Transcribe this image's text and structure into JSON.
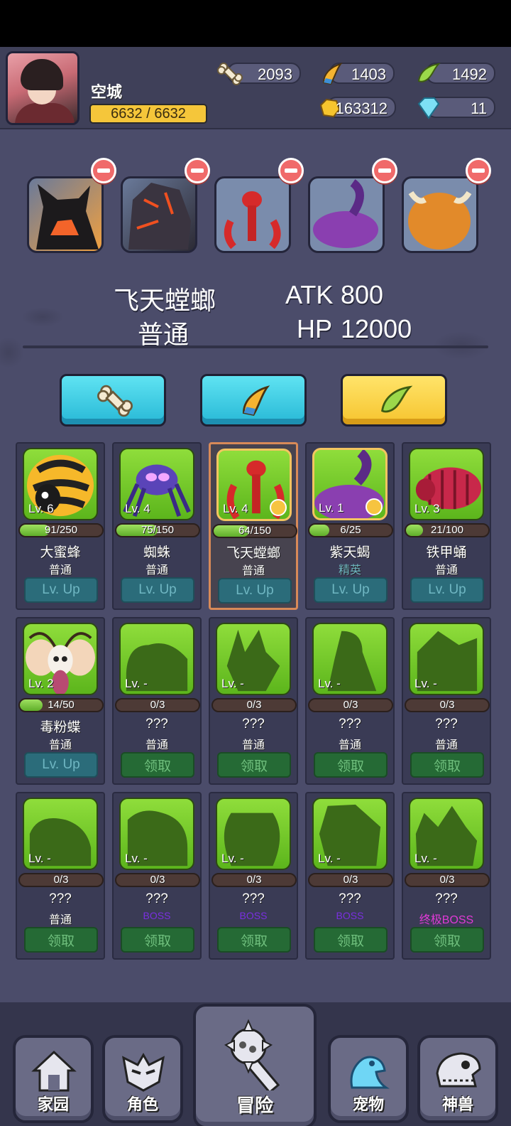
{
  "player": {
    "name": "空城",
    "hp_text": "6632 / 6632"
  },
  "resources": {
    "bone": "2093",
    "horn": "1403",
    "leaf": "1492",
    "gold": "163312",
    "diamond": "11"
  },
  "colors": {
    "bg": "#4b4c6a",
    "cell_green": "#8fdd3b",
    "btn_blue": "#27b8d6",
    "btn_yellow": "#f6c42e",
    "rank_elite": "#6fb6c2",
    "rank_boss": "#7a2fe0",
    "rank_ultimate_boss": "#e03ad6"
  },
  "team": [
    {
      "name": "fox-pet",
      "icon": "fox"
    },
    {
      "name": "rock-golem-pet",
      "icon": "rock"
    },
    {
      "name": "mantis-pet",
      "icon": "mantis"
    },
    {
      "name": "scorpion-pet",
      "icon": "scorpion"
    },
    {
      "name": "yak-pet",
      "icon": "yak"
    }
  ],
  "selected": {
    "name": "飞天螳螂",
    "rank": "普通",
    "atk_label": "ATK",
    "atk_value": "800",
    "hp_label": "HP",
    "hp_value": "12000"
  },
  "tabs": [
    {
      "icon": "bone-icon",
      "active": false
    },
    {
      "icon": "horn-icon",
      "active": false
    },
    {
      "icon": "leaf-icon",
      "active": true
    }
  ],
  "pets": [
    {
      "name": "大蜜蜂",
      "rank": "普通",
      "level": "Lv. 6",
      "progress": "91/250",
      "fill": 0.364,
      "button": "Lv. Up",
      "owned": true
    },
    {
      "name": "蜘蛛",
      "rank": "普通",
      "level": "Lv. 4",
      "progress": "75/150",
      "fill": 0.5,
      "button": "Lv. Up",
      "owned": true
    },
    {
      "name": "飞天螳螂",
      "rank": "普通",
      "level": "Lv. 4",
      "progress": "64/150",
      "fill": 0.427,
      "button": "Lv. Up",
      "owned": true
    },
    {
      "name": "紫天蝎",
      "rank": "精英",
      "level": "Lv. 1",
      "progress": "6/25",
      "fill": 0.24,
      "button": "Lv. Up",
      "owned": true
    },
    {
      "name": "铁甲蛹",
      "rank": "普通",
      "level": "Lv. 3",
      "progress": "21/100",
      "fill": 0.21,
      "button": "Lv. Up",
      "owned": true
    },
    {
      "name": "毒粉蝶",
      "rank": "普通",
      "level": "Lv. 2",
      "progress": "14/50",
      "fill": 0.28,
      "button": "Lv. Up",
      "owned": true
    },
    {
      "name": "???",
      "rank": "普通",
      "level": "Lv. -",
      "progress": "0/3",
      "fill": 0,
      "button": "领取",
      "owned": false
    },
    {
      "name": "???",
      "rank": "普通",
      "level": "Lv. -",
      "progress": "0/3",
      "fill": 0,
      "button": "领取",
      "owned": false
    },
    {
      "name": "???",
      "rank": "普通",
      "level": "Lv. -",
      "progress": "0/3",
      "fill": 0,
      "button": "领取",
      "owned": false
    },
    {
      "name": "???",
      "rank": "普通",
      "level": "Lv. -",
      "progress": "0/3",
      "fill": 0,
      "button": "领取",
      "owned": false
    },
    {
      "name": "???",
      "rank": "普通",
      "level": "Lv. -",
      "progress": "0/3",
      "fill": 0,
      "button": "领取",
      "owned": false
    },
    {
      "name": "???",
      "rank": "BOSS",
      "level": "Lv. -",
      "progress": "0/3",
      "fill": 0,
      "button": "领取",
      "owned": false
    },
    {
      "name": "???",
      "rank": "BOSS",
      "level": "Lv. -",
      "progress": "0/3",
      "fill": 0,
      "button": "领取",
      "owned": false
    },
    {
      "name": "???",
      "rank": "BOSS",
      "level": "Lv. -",
      "progress": "0/3",
      "fill": 0,
      "button": "领取",
      "owned": false
    },
    {
      "name": "???",
      "rank": "终极BOSS",
      "level": "Lv. -",
      "progress": "0/3",
      "fill": 0,
      "button": "领取",
      "owned": false
    }
  ],
  "nav": [
    {
      "label": "家园",
      "icon": "home-icon"
    },
    {
      "label": "角色",
      "icon": "mask-icon"
    },
    {
      "label": "冒险",
      "icon": "spiked-mace-icon"
    },
    {
      "label": "宠物",
      "icon": "frog-icon"
    },
    {
      "label": "神兽",
      "icon": "dino-skull-icon"
    }
  ]
}
